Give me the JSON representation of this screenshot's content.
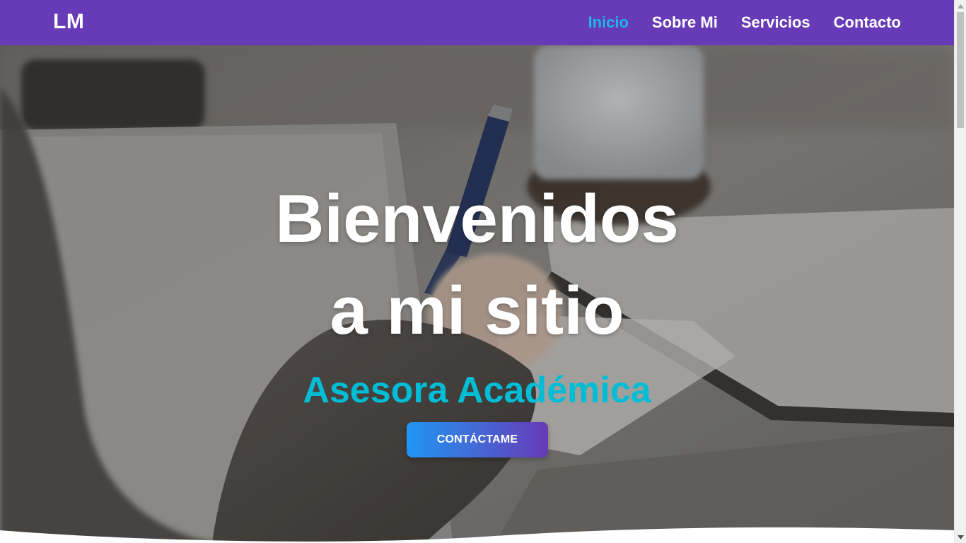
{
  "navbar": {
    "brand": "LM",
    "links": [
      {
        "label": "Inicio",
        "active": true
      },
      {
        "label": "Sobre Mi",
        "active": false
      },
      {
        "label": "Servicios",
        "active": false
      },
      {
        "label": "Contacto",
        "active": false
      }
    ]
  },
  "hero": {
    "title_line1": "Bienvenidos",
    "title_line2": "a mi sitio",
    "subtitle": "Asesora Académica",
    "cta_label": "CONTÁCTAME"
  },
  "colors": {
    "navbar_bg": "#673ab7",
    "active_link": "#1fb6e6",
    "subtitle": "#00bcd4",
    "cta_gradient_start": "#2196f3",
    "cta_gradient_end": "#673ab7"
  },
  "icons": {
    "scroll_up": "triangle-up-icon",
    "scroll_down": "triangle-down-icon"
  }
}
